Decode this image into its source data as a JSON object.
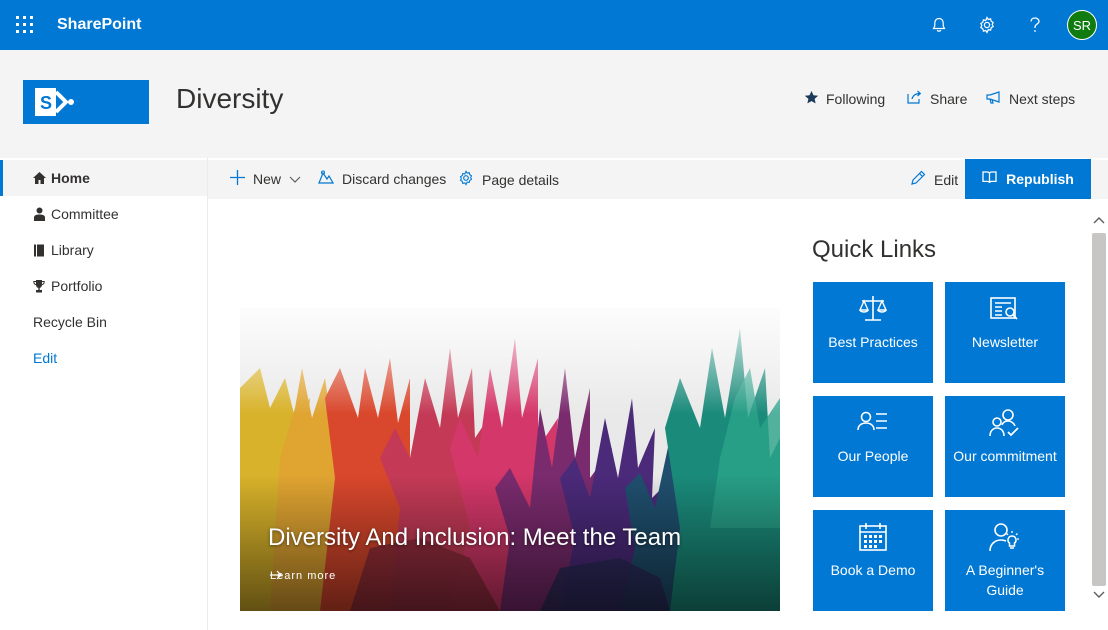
{
  "suitebar": {
    "brand": "SharePoint",
    "avatar_initials": "SR",
    "icons": [
      "waffle-icon",
      "bell-icon",
      "gear-icon",
      "help-icon"
    ]
  },
  "header": {
    "site_title": "Diversity",
    "actions": {
      "following": "Following",
      "share": "Share",
      "next_steps": "Next steps"
    }
  },
  "nav": {
    "items": [
      {
        "label": "Home",
        "icon": "home-icon"
      },
      {
        "label": "Committee",
        "icon": "person-icon"
      },
      {
        "label": "Library",
        "icon": "book-icon"
      },
      {
        "label": "Portfolio",
        "icon": "trophy-icon"
      },
      {
        "label": "Recycle Bin",
        "icon": ""
      },
      {
        "label": "Edit",
        "icon": ""
      }
    ]
  },
  "commands": {
    "new": "New",
    "discard": "Discard changes",
    "page_details": "Page details",
    "edit": "Edit",
    "republish": "Republish"
  },
  "hero": {
    "title": "Diversity And Inclusion: Meet the Team",
    "link": "Learn more"
  },
  "quick_links": {
    "title": "Quick Links",
    "tiles": [
      {
        "label": "Best Practices",
        "icon": "scales-icon"
      },
      {
        "label": "Newsletter",
        "icon": "newspaper-icon"
      },
      {
        "label": "Our People",
        "icon": "people-list-icon"
      },
      {
        "label": "Our commitment",
        "icon": "people-check-icon"
      },
      {
        "label": "Book a Demo",
        "icon": "calendar-icon"
      },
      {
        "label": "A Beginner's Guide",
        "icon": "person-lightbulb-icon"
      }
    ]
  },
  "colors": {
    "accent": "#0078d4",
    "header_bg": "#f4f4f4",
    "avatar": "#107c10"
  }
}
